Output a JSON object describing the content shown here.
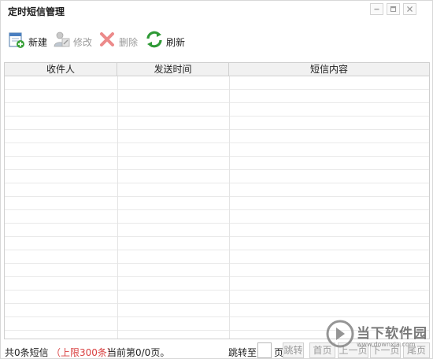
{
  "window": {
    "title": "定时短信管理",
    "controls": [
      "minimize-icon",
      "maximize-icon",
      "close-icon"
    ]
  },
  "toolbar": {
    "new_label": "新建",
    "edit_label": "修改",
    "delete_label": "删除",
    "refresh_label": "刷新",
    "icons": {
      "new": "new-document-icon",
      "edit": "edit-user-icon",
      "delete": "delete-x-icon",
      "refresh": "refresh-arrows-icon"
    }
  },
  "table": {
    "columns": [
      "收件人",
      "发送时间",
      "短信内容"
    ],
    "rows": []
  },
  "status": {
    "total": "共0条短信",
    "limit": "（上限300条）",
    "page": "当前第0/0页。",
    "goto_label": "跳转至",
    "page_input": "",
    "page_unit": "页",
    "jump_button": "跳转",
    "first_button": "首页",
    "prev_button": "上一页",
    "next_button": "下一页",
    "last_button": "尾页"
  },
  "watermark": {
    "name": "当下软件园",
    "url": "www.downxia.com"
  },
  "colors": {
    "limit_text": "#d94040",
    "disabled_text": "#9a9a9a",
    "header_bg": "#f1f1f1",
    "grid_line": "#e9e9e9"
  }
}
